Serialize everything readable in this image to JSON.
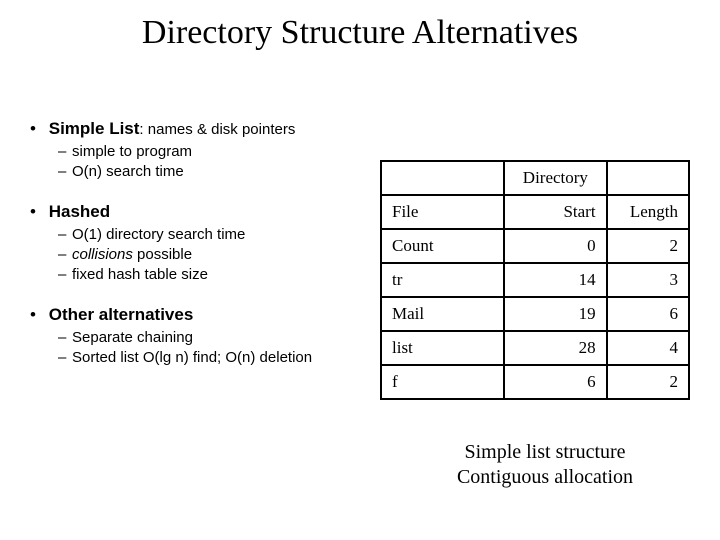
{
  "title": "Directory Structure Alternatives",
  "bullets": {
    "simple_list": {
      "label": "Simple List",
      "suffix": ": names & disk pointers",
      "sub": [
        "simple to program",
        "O(n) search time"
      ]
    },
    "hashed": {
      "label": "Hashed",
      "sub": [
        "O(1) directory search time",
        "collisions possible",
        "fixed hash table size"
      ],
      "sub_italic_word": "collisions"
    },
    "other": {
      "label": "Other alternatives",
      "sub": [
        "Separate chaining",
        "Sorted list O(lg n) find; O(n) deletion"
      ]
    }
  },
  "table": {
    "header_label": "Directory",
    "cols": [
      "File",
      "Start",
      "Length"
    ],
    "rows": [
      {
        "file": "Count",
        "start": 0,
        "length": 2
      },
      {
        "file": "tr",
        "start": 14,
        "length": 3
      },
      {
        "file": "Mail",
        "start": 19,
        "length": 6
      },
      {
        "file": "list",
        "start": 28,
        "length": 4
      },
      {
        "file": "f",
        "start": 6,
        "length": 2
      }
    ]
  },
  "caption": {
    "line1": "Simple list structure",
    "line2": "Contiguous allocation"
  },
  "chart_data": {
    "type": "table",
    "title": "Directory",
    "columns": [
      "File",
      "Start",
      "Length"
    ],
    "rows": [
      [
        "Count",
        0,
        2
      ],
      [
        "tr",
        14,
        3
      ],
      [
        "Mail",
        19,
        6
      ],
      [
        "list",
        28,
        4
      ],
      [
        "f",
        6,
        2
      ]
    ]
  }
}
